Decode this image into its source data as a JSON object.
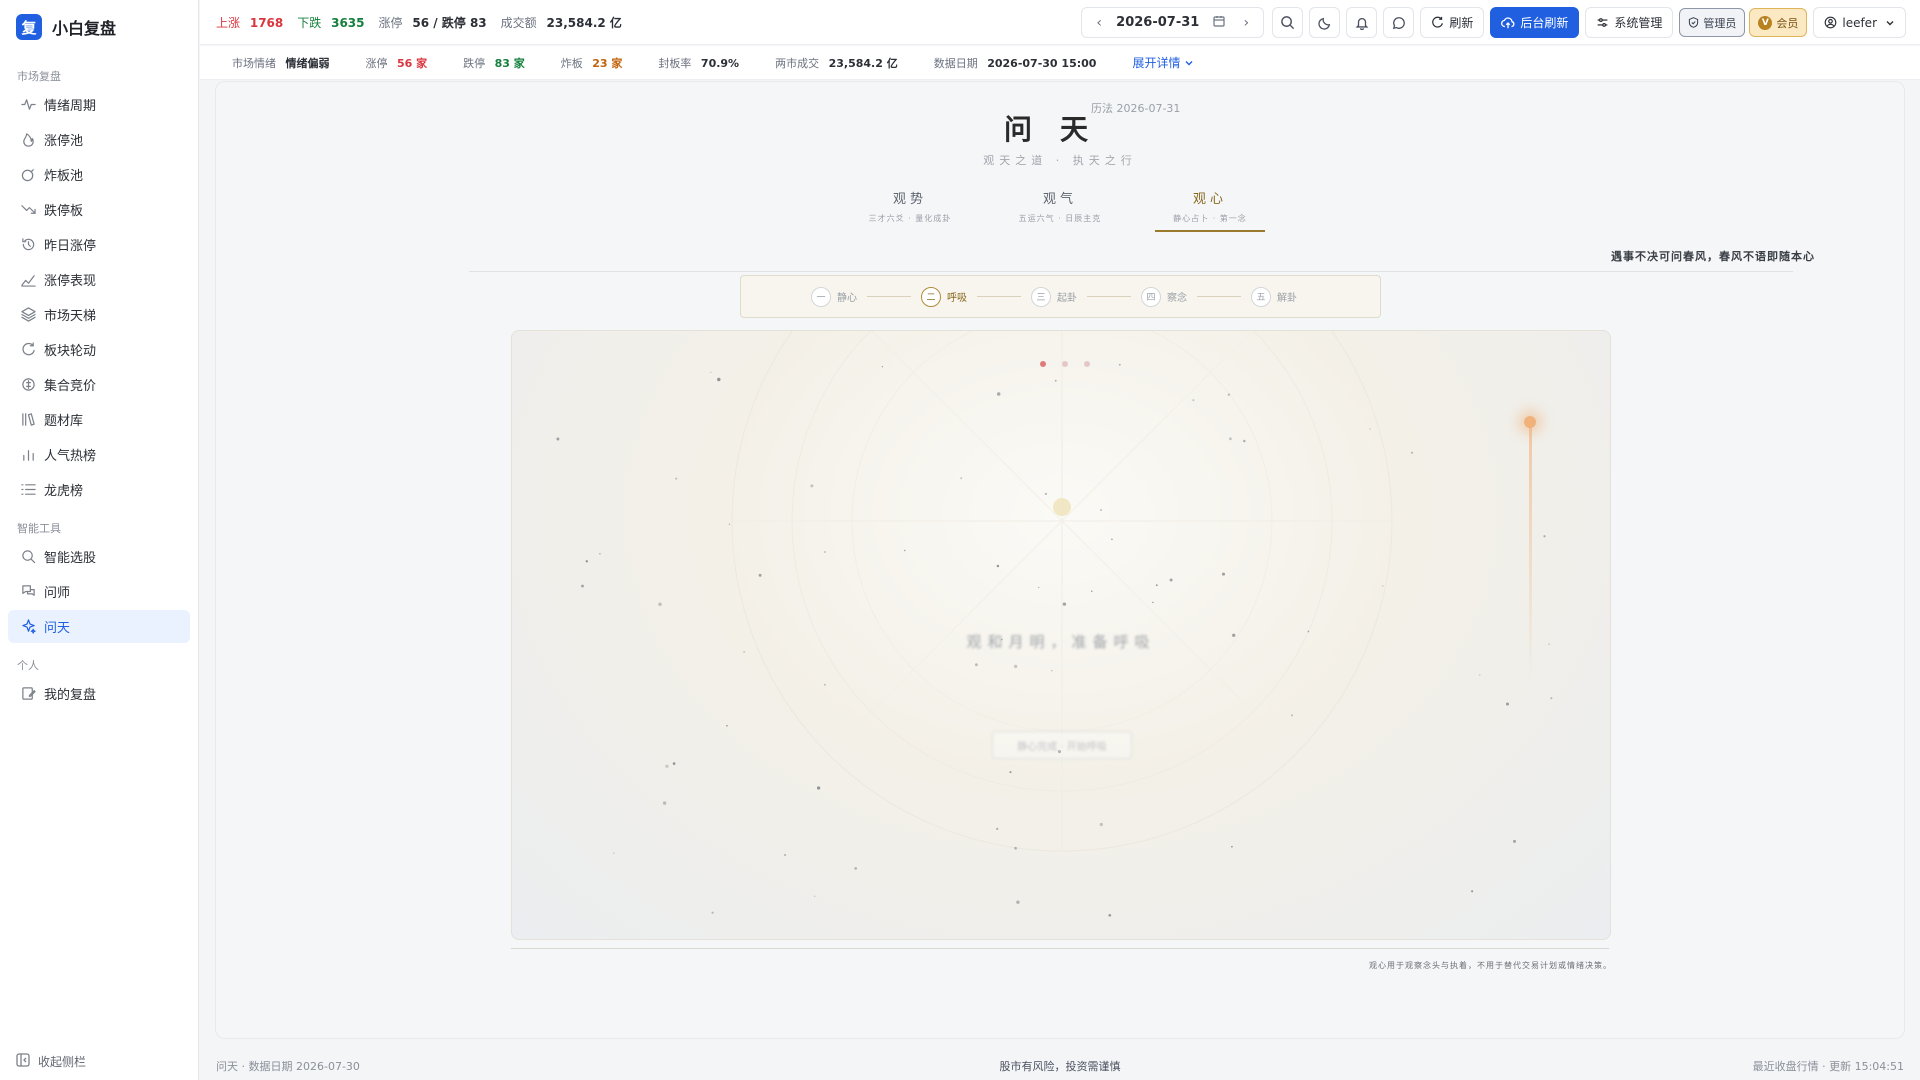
{
  "brand": {
    "logo": "复",
    "name": "小白复盘"
  },
  "sidebar": {
    "groups": [
      {
        "title": "市场复盘",
        "items": [
          {
            "label": "情绪周期",
            "icon": "pulse-icon"
          },
          {
            "label": "涨停池",
            "icon": "flame-icon"
          },
          {
            "label": "炸板池",
            "icon": "bomb-icon"
          },
          {
            "label": "跌停板",
            "icon": "trend-down-icon"
          },
          {
            "label": "昨日涨停",
            "icon": "history-icon"
          },
          {
            "label": "涨停表现",
            "icon": "chart-line-icon"
          },
          {
            "label": "市场天梯",
            "icon": "layers-icon"
          },
          {
            "label": "板块轮动",
            "icon": "refresh-icon"
          },
          {
            "label": "集合竞价",
            "icon": "coins-icon"
          },
          {
            "label": "题材库",
            "icon": "library-icon"
          },
          {
            "label": "人气热榜",
            "icon": "bar-chart-icon"
          },
          {
            "label": "龙虎榜",
            "icon": "list-icon"
          }
        ]
      },
      {
        "title": "智能工具",
        "items": [
          {
            "label": "智能选股",
            "icon": "search-icon"
          },
          {
            "label": "问师",
            "icon": "chat-icon"
          },
          {
            "label": "问天",
            "icon": "sparkle-icon",
            "active": true
          }
        ]
      },
      {
        "title": "个人",
        "items": [
          {
            "label": "我的复盘",
            "icon": "edit-icon"
          }
        ]
      }
    ],
    "collapse_label": "收起侧栏"
  },
  "topbar": {
    "stats": [
      {
        "key": "上涨",
        "value": "1768",
        "color": "red"
      },
      {
        "key": "下跌",
        "value": "3635",
        "color": "green"
      },
      {
        "key": "涨停",
        "value": "56 / 跌停 83",
        "color": "plain"
      },
      {
        "key": "成交额",
        "value": "23,584.2 亿",
        "color": "plain"
      }
    ],
    "date": "2026-07-31",
    "refresh_label": "刷新",
    "bg_refresh_label": "后台刷新",
    "sys_label": "系统管理",
    "admin_label": "管理员",
    "vip_label": "会员",
    "vip_letter": "V",
    "user": "leefer"
  },
  "subbar": {
    "items": [
      {
        "key": "市场情绪",
        "value": "情绪偏弱",
        "color": "plain"
      },
      {
        "key": "涨停",
        "value": "56 家",
        "color": "red"
      },
      {
        "key": "跌停",
        "value": "83 家",
        "color": "green"
      },
      {
        "key": "炸板",
        "value": "23 家",
        "color": "orange"
      },
      {
        "key": "封板率",
        "value": "70.9%",
        "color": "plain"
      },
      {
        "key": "两市成交",
        "value": "23,584.2 亿",
        "color": "plain"
      },
      {
        "key": "数据日期",
        "value": "2026-07-30 15:00",
        "color": "plain"
      }
    ],
    "expand_label": "展开详情"
  },
  "main": {
    "title": "问天",
    "date_label": "历法 2026-07-31",
    "subtitle": "观天之道 · 执天之行",
    "tabs": [
      {
        "name": "观势",
        "desc": "三才六爻 · 量化成卦"
      },
      {
        "name": "观气",
        "desc": "五运六气 · 日辰主克"
      },
      {
        "name": "观心",
        "desc": "静心占卜 · 第一念",
        "active": true
      }
    ],
    "quote": "遇事不决可问春风，春风不语即随本心",
    "steps": [
      {
        "num": "一",
        "label": "静心"
      },
      {
        "num": "二",
        "label": "呼吸",
        "active": true
      },
      {
        "num": "三",
        "label": "起卦"
      },
      {
        "num": "四",
        "label": "察念"
      },
      {
        "num": "五",
        "label": "解卦"
      }
    ],
    "canvas_text": "观和月明，准备呼吸",
    "canvas_button": "静心完成 · 开始呼吸",
    "footnote": "观心用于观察念头与执着，不用于替代交易计划或情绪决策。"
  },
  "status": {
    "left": "问天 · 数据日期 2026-07-30",
    "center": "股市有风险，投资需谨慎",
    "right": "最近收盘行情 · 更新 15:04:51"
  }
}
